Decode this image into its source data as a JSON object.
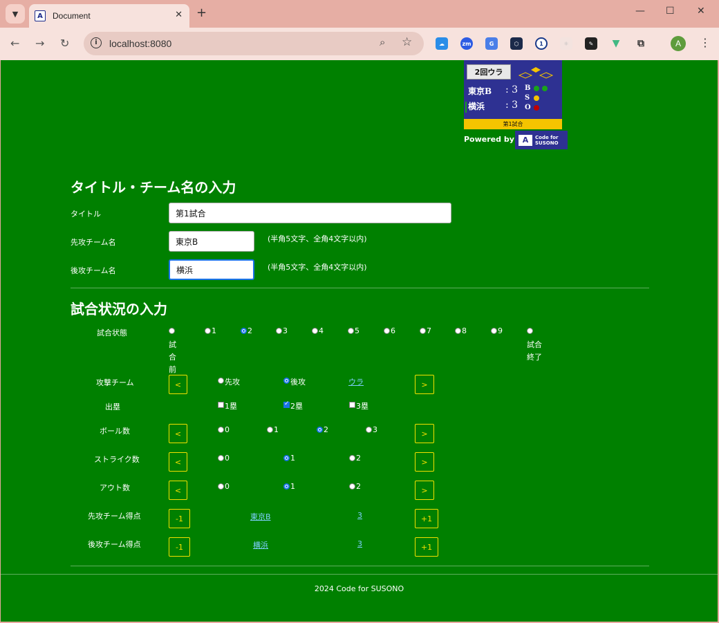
{
  "browser": {
    "tab_title": "Document",
    "url": "localhost:8080"
  },
  "scoreboard": {
    "inning": "2回ウラ",
    "away_team": "東京B",
    "home_team": "横浜",
    "away_score": ": 3",
    "home_score": ": 3",
    "b_label": "B",
    "s_label": "S",
    "o_label": "O",
    "title": "第1試合",
    "powered_by": "Powered by",
    "logo_text_1": "Code for",
    "logo_text_2": "SUSONO",
    "colors": {
      "ball": "#1aa31a",
      "strike": "#f5c400",
      "out": "#c00000"
    }
  },
  "section1": {
    "heading": "タイトル・チーム名の入力",
    "title_label": "タイトル",
    "title_value": "第1試合",
    "away_label": "先攻チーム名",
    "away_value": "東京B",
    "home_label": "後攻チーム名",
    "home_value": "横浜",
    "length_note": "(半角5文字、全角4文字以内)"
  },
  "section2": {
    "heading": "試合状況の入力",
    "state_label": "試合状態",
    "state_options": [
      "試合前",
      "1",
      "2",
      "3",
      "4",
      "5",
      "6",
      "7",
      "8",
      "9",
      "試合終了"
    ],
    "state_selected": "2",
    "attack_label": "攻撃チーム",
    "attack_options": [
      "先攻",
      "後攻"
    ],
    "attack_selected": "後攻",
    "attack_link": "ウラ",
    "base_label": "出塁",
    "base_options": [
      "1塁",
      "2塁",
      "3塁"
    ],
    "base_checked": [
      "2塁"
    ],
    "ball_label": "ボール数",
    "ball_options": [
      "0",
      "1",
      "2",
      "3"
    ],
    "ball_selected": "2",
    "strike_label": "ストライク数",
    "strike_options": [
      "0",
      "1",
      "2"
    ],
    "strike_selected": "1",
    "out_label": "アウト数",
    "out_options": [
      "0",
      "1",
      "2"
    ],
    "out_selected": "1",
    "away_score_label": "先攻チーム得点",
    "away_score_team": "東京B",
    "away_score_value": "3",
    "home_score_label": "後攻チーム得点",
    "home_score_team": "横浜",
    "home_score_value": "3",
    "prev": "<",
    "next": ">",
    "minus": "-1",
    "plus": "+1"
  },
  "footer": "2024 Code for SUSONO"
}
